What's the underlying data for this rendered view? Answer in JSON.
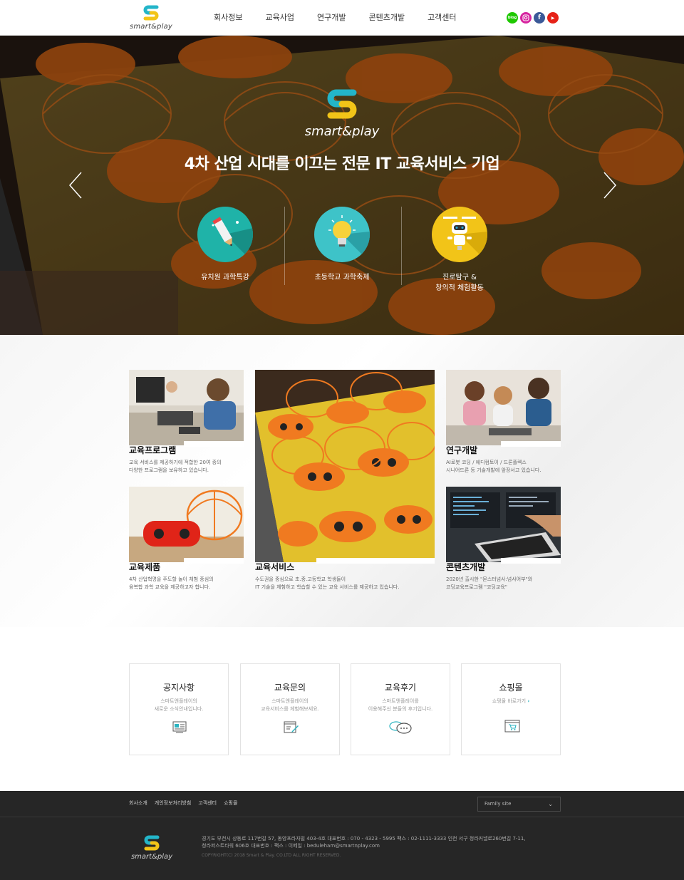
{
  "header": {
    "logo_text": "smart&play",
    "nav": [
      "회사정보",
      "교육사업",
      "연구개발",
      "콘텐츠개발",
      "고객센터"
    ],
    "social": [
      {
        "name": "blog",
        "label": "blog",
        "color": "#1ec800"
      },
      {
        "name": "instagram",
        "label": "",
        "color": "#d6249f"
      },
      {
        "name": "facebook",
        "label": "f",
        "color": "#3b5998"
      },
      {
        "name": "youtube",
        "label": "▶",
        "color": "#e62117"
      }
    ]
  },
  "hero": {
    "logo_text": "smart&play",
    "title": "4차 산업 시대를 이끄는 전문 IT 교육서비스 기업",
    "features": [
      {
        "label": "유치원 과학특강",
        "color": "#1fb3a8",
        "icon": "pencil-rocket-icon"
      },
      {
        "label": "초등학교 과학축제",
        "color": "#3ec3c8",
        "icon": "lightbulb-icon"
      },
      {
        "label_line1": "진로탐구 &",
        "label_line2": "창의적 체험활동",
        "color": "#f2c418",
        "icon": "robot-icon"
      }
    ]
  },
  "services": {
    "program": {
      "title": "교육프로그램",
      "desc1": "교육 서비스를 제공하기에 적합한 20여 종의",
      "desc2": "다양한 프로그램을 보유하고 있습니다."
    },
    "products": {
      "title": "교육제품",
      "desc1": "4차 산업혁명을 주도할 놀이 체험 중심의",
      "desc2": "융복합 과학 교육을 제공하고자 합니다."
    },
    "service": {
      "title": "교육서비스",
      "desc1": "수도권을 중심으로 초.중.고등학교 학생들이",
      "desc2": "IT 기술을 체험하고 학습할 수 있는 교육 서비스를 제공하고 있습니다."
    },
    "research": {
      "title": "연구개발",
      "desc1": "AI로봇 코딩 / 에디컴토이 / 드론플렉스",
      "desc2": "시니어드론 등 기술개발에 앞장서고 있습니다."
    },
    "content": {
      "title": "콘텐츠개발",
      "desc1": "2020년 출시한 \"몬스터넘사:넘사어부\"와",
      "desc2": "코딩교육프로그램 \"코딩교육\""
    }
  },
  "boxes": [
    {
      "title": "공지사항",
      "line1": "스마트앤플레이의",
      "line2": "새로운 소식안내입니다.",
      "icon": "notice-board-icon"
    },
    {
      "title": "교육문의",
      "line1": "스마트앤플레이의",
      "line2": "교육서비스를 체험해보세요.",
      "icon": "edit-form-icon"
    },
    {
      "title": "교육후기",
      "line1": "스마트앤플레이를",
      "line2": "이용해주신 분들의 후기입니다.",
      "icon": "chat-bubbles-icon"
    },
    {
      "title": "쇼핑몰",
      "line1": "쇼핑몰 바로가기",
      "line2": "",
      "icon": "shopping-cart-icon"
    }
  ],
  "footer": {
    "links": [
      "회사소개",
      "개인정보처리방침",
      "고객센터",
      "쇼핑몰"
    ],
    "family_site": "Family site",
    "logo_text": "smart&play",
    "info_line1": "경기도 부천시 상동로 117번길 57, 동양프라자빌 403-4호    대표번호 : 070 - 4323 - 5995    팩스 : 02-1111-3333    인천 서구 청라커낼로260번길 7-11,",
    "info_line2": "청라퍼스트타워 606호    대표번호 :      팩스 :      이메일 : beduleham@smartnplay.com",
    "copyright": "COPYRIGHT(C) 2018 Smart & Play. CO.LTD ALL RIGHT RESERVED."
  }
}
